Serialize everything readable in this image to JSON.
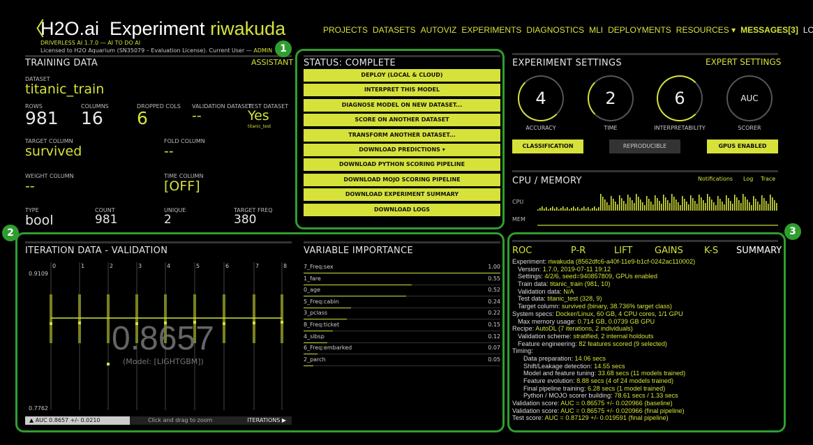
{
  "header": {
    "back_glyph": "〈",
    "brand": "H2O.ai",
    "title_prefix": "Experiment",
    "experiment_name": "riwakuda",
    "version_line": "DRIVERLESS AI 1.7.0 — AI TO DO AI",
    "license_text": "Licensed to H2O Aquarium (SN35079 – Evaluation License). Current User —",
    "current_user": "ADMIN"
  },
  "nav": {
    "projects": "PROJECTS",
    "datasets": "DATASETS",
    "autoviz": "AUTOVIZ",
    "experiments": "EXPERIMENTS",
    "diagnostics": "DIAGNOSTICS",
    "mli": "MLI",
    "deployments": "DEPLOYMENTS",
    "resources": "RESOURCES ▾",
    "messages": "MESSAGES[3]",
    "logout": "LOGOUT"
  },
  "training": {
    "title": "TRAINING DATA",
    "assistant": "ASSISTANT",
    "dataset_label": "DATASET",
    "dataset": "titanic_train",
    "rows_label": "ROWS",
    "rows": "981",
    "columns_label": "COLUMNS",
    "columns": "16",
    "dropped_label": "DROPPED COLS",
    "dropped": "6",
    "validation_label": "VALIDATION DATASET",
    "validation": "--",
    "test_label": "TEST DATASET",
    "test": "Yes",
    "test_name": "titanic_test",
    "target_label": "TARGET COLUMN",
    "target": "survived",
    "fold_label": "FOLD COLUMN",
    "fold": "--",
    "weight_label": "WEIGHT COLUMN",
    "weight": "--",
    "time_label": "TIME COLUMN",
    "time": "[OFF]",
    "type_label": "TYPE",
    "type": "bool",
    "count_label": "COUNT",
    "count": "981",
    "unique_label": "UNIQUE",
    "unique": "2",
    "freq_label": "TARGET FREQ",
    "freq": "380"
  },
  "status": {
    "title": "STATUS: COMPLETE",
    "buttons": [
      "DEPLOY (LOCAL & CLOUD)",
      "INTERPRET THIS MODEL",
      "DIAGNOSE MODEL ON NEW DATASET...",
      "SCORE ON ANOTHER DATASET",
      "TRANSFORM ANOTHER DATASET...",
      "DOWNLOAD PREDICTIONS ▾",
      "DOWNLOAD PYTHON SCORING PIPELINE",
      "DOWNLOAD MOJO SCORING PIPELINE",
      "DOWNLOAD EXPERIMENT SUMMARY",
      "DOWNLOAD LOGS"
    ]
  },
  "settings": {
    "title": "EXPERIMENT SETTINGS",
    "expert": "EXPERT SETTINGS",
    "accuracy": "4",
    "accuracy_label": "ACCURACY",
    "time": "2",
    "time_label": "TIME",
    "interpretability": "6",
    "interpretability_label": "INTERPRETABILITY",
    "scorer": "AUC",
    "scorer_label": "SCORER",
    "classification": "CLASSIFICATION",
    "reproducible": "REPRODUCIBLE",
    "gpus": "GPUS ENABLED"
  },
  "cpu": {
    "title": "CPU / MEMORY",
    "notifications": "Notifications",
    "log": "Log",
    "trace": "Trace",
    "cpu_label": "CPU",
    "mem_label": "MEM"
  },
  "iteration": {
    "title": "ITERATION DATA - VALIDATION",
    "ymax": "0.9109",
    "ymin": "0.7762",
    "x_ticks": [
      "0",
      "1",
      "2",
      "3",
      "4",
      "5",
      "6",
      "7",
      "8"
    ],
    "score": "0.8657",
    "model": "(Model: [LIGHTGBM])",
    "footer_auc": "▲ AUC 0.8657 +/- 0.0210",
    "footer_zoom": "Click and drag to zoom",
    "footer_iter": "ITERATIONS ▶"
  },
  "varimp": {
    "title": "VARIABLE IMPORTANCE",
    "rows": [
      {
        "name": "7_Freq:sex",
        "value": "1.00",
        "v": 1.0
      },
      {
        "name": "1_fare",
        "value": "0.55",
        "v": 0.55
      },
      {
        "name": "0_age",
        "value": "0.52",
        "v": 0.52
      },
      {
        "name": "5_Freq:cabin",
        "value": "0.24",
        "v": 0.24
      },
      {
        "name": "3_pclass",
        "value": "0.22",
        "v": 0.22
      },
      {
        "name": "8_Freq:ticket",
        "value": "0.15",
        "v": 0.15
      },
      {
        "name": "4_sibsp",
        "value": "0.12",
        "v": 0.12
      },
      {
        "name": "6_Freq:embarked",
        "value": "0.07",
        "v": 0.07
      },
      {
        "name": "2_parch",
        "value": "0.05",
        "v": 0.05
      }
    ]
  },
  "summary_tabs": {
    "roc": "ROC",
    "pr": "P-R",
    "lift": "LIFT",
    "gains": "GAINS",
    "ks": "K-S",
    "summary": "SUMMARY"
  },
  "summary": [
    {
      "k": "Experiment: ",
      "v": "riwakuda (8562dfc6-a40f-11e9-b1cf-0242ac110002)",
      "indent": 0
    },
    {
      "k": "Version: ",
      "v": "1.7.0, 2019-07-11 19:12",
      "indent": 1
    },
    {
      "k": "Settings: ",
      "v": "4/2/6, seed=940857809, GPUs enabled",
      "indent": 1
    },
    {
      "k": "Train data: ",
      "v": "titanic_train (981, 10)",
      "indent": 1
    },
    {
      "k": "Validation data: ",
      "v": "N/A",
      "indent": 1
    },
    {
      "k": "Test data: ",
      "v": "titanic_test (328, 9)",
      "indent": 1
    },
    {
      "k": "Target column: ",
      "v": "survived (binary, 38.736% target class)",
      "indent": 1
    },
    {
      "k": "System specs: ",
      "v": "Docker/Linux, 60 GB, 4 CPU cores, 1/1 GPU",
      "indent": 0
    },
    {
      "k": "Max memory usage: ",
      "v": "0.714 GB, 0.0739 GB GPU",
      "indent": 1
    },
    {
      "k": "Recipe: ",
      "v": "AutoDL (7 iterations, 2 individuals)",
      "indent": 0
    },
    {
      "k": "Validation scheme: ",
      "v": "stratified, 2 internal holdouts",
      "indent": 1
    },
    {
      "k": "Feature engineering: ",
      "v": "82 features scored (9 selected)",
      "indent": 1
    },
    {
      "k": "Timing:",
      "v": "",
      "indent": 0
    },
    {
      "k": "Data preparation: ",
      "v": "14.06 secs",
      "indent": 2
    },
    {
      "k": "Shift/Leakage detection: ",
      "v": "14.55 secs",
      "indent": 2
    },
    {
      "k": "Model and feature tuning: ",
      "v": "33.68 secs (11 models trained)",
      "indent": 2
    },
    {
      "k": "Feature evolution: ",
      "v": "8.88 secs (4 of 24 models trained)",
      "indent": 2
    },
    {
      "k": "Final pipeline training: ",
      "v": "6.28 secs (1 model trained)",
      "indent": 2
    },
    {
      "k": "Python / MOJO scorer building: ",
      "v": "78.61 secs / 1.33 secs",
      "indent": 2
    },
    {
      "k": "Validation score: ",
      "v": "AUC = 0.86575 +/- 0.020966 (baseline)",
      "indent": 0
    },
    {
      "k": "Validation score: ",
      "v": "AUC = 0.86575 +/- 0.020966 (final pipeline)",
      "indent": 0
    },
    {
      "k": "Test score:         ",
      "v": "AUC = 0.87129 +/- 0.019591 (final pipeline)",
      "indent": 0
    }
  ],
  "badges": [
    "1",
    "2",
    "3"
  ],
  "colors": {
    "accent": "#d6e23a",
    "highlight": "#2f9e2f",
    "background": "#000000"
  }
}
